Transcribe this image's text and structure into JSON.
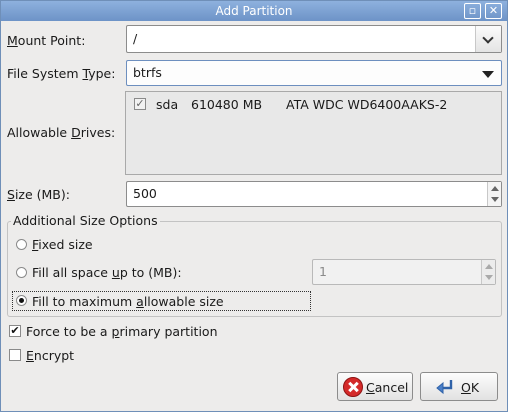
{
  "window": {
    "title": "Add Partition",
    "restore_glyph": "▫",
    "close_glyph": "✕"
  },
  "mount_point": {
    "label_u": "M",
    "label_rest": "ount Point:",
    "value": "/"
  },
  "fs_type": {
    "label_pre": "File System ",
    "label_u": "T",
    "label_post": "ype:",
    "value": "btrfs"
  },
  "drives": {
    "label_pre": "Allowable ",
    "label_u": "D",
    "label_post": "rives:",
    "rows": [
      {
        "name": "sda",
        "size": "610480 MB",
        "model": "ATA WDC WD6400AAKS-2",
        "checked": true
      }
    ]
  },
  "size": {
    "label_u": "S",
    "label_rest": "ize (MB):",
    "value": "500"
  },
  "additional": {
    "title": "Additional Size Options",
    "fixed": {
      "u": "F",
      "rest": "ixed size"
    },
    "fill_upto": {
      "pre": "Fill all space ",
      "u": "u",
      "post": "p to (MB):",
      "value": "1"
    },
    "fill_max": {
      "pre": "Fill to maximum ",
      "u": "a",
      "post": "llowable size"
    },
    "selected": "fill_max"
  },
  "primary": {
    "pre": "Force to be a ",
    "u": "p",
    "post": "rimary partition",
    "checked": true
  },
  "encrypt": {
    "u": "E",
    "rest": "ncrypt",
    "checked": false
  },
  "buttons": {
    "cancel_u": "C",
    "cancel_rest": "ancel",
    "ok_u": "O",
    "ok_rest": "K"
  },
  "icons": {
    "cancel": "cancel-icon",
    "ok": "ok-icon"
  },
  "colors": {
    "titlebar": "#7aa0d2",
    "cancel_icon": "#d42a2a"
  }
}
